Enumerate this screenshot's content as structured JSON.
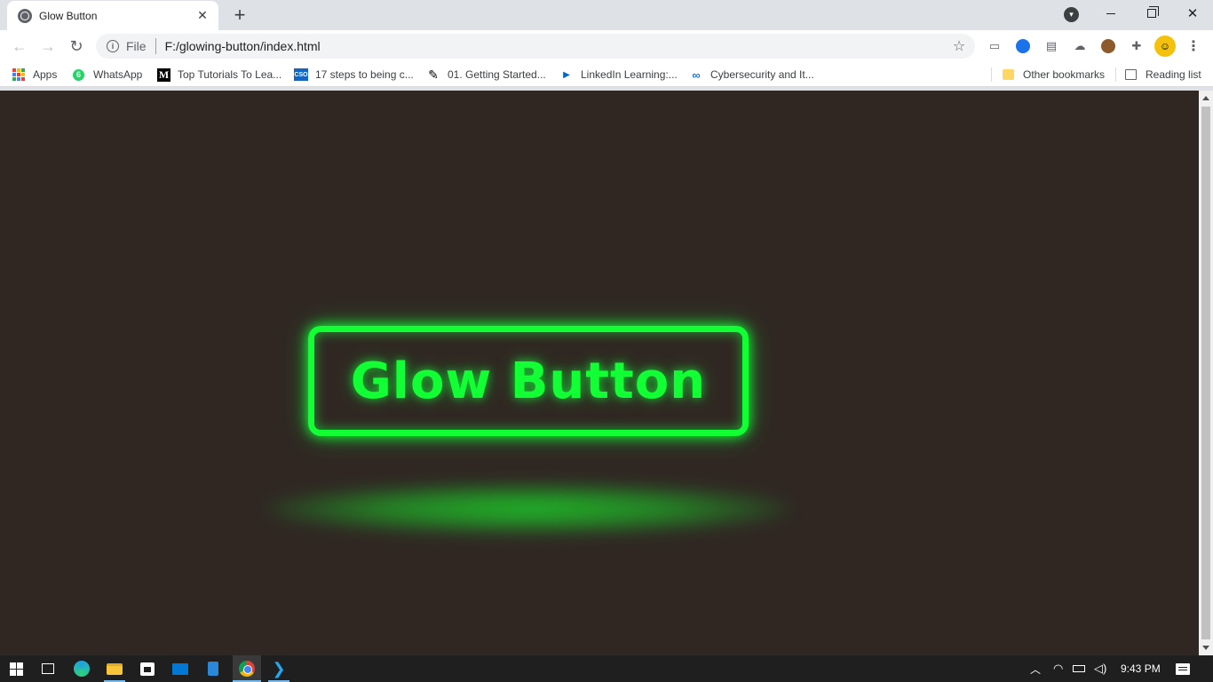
{
  "browser": {
    "tab_title": "Glow Button",
    "tab_close": "✕",
    "new_tab": "+",
    "scheme_label": "File",
    "url": "F:/glowing-button/index.html"
  },
  "bookmarks": {
    "apps": "Apps",
    "whatsapp": "WhatsApp",
    "whatsapp_badge": "6",
    "medium": "Top Tutorials To Lea...",
    "medium_icon": "M",
    "cso": "17 steps to being c...",
    "cso_icon": "CSO",
    "getting_started": "01. Getting Started...",
    "linkedin": "LinkedIn Learning:...",
    "cyber": "Cybersecurity and It...",
    "other": "Other bookmarks",
    "reading_list": "Reading list"
  },
  "page": {
    "button_label": "Glow Button",
    "background_color": "#302723",
    "glow_color": "#12ff36"
  },
  "taskbar": {
    "time": "9:43 PM"
  },
  "icons": {
    "back": "back-arrow-icon",
    "forward": "forward-arrow-icon",
    "reload": "reload-icon",
    "star": "star-icon",
    "menu": "kebab-menu-icon"
  }
}
